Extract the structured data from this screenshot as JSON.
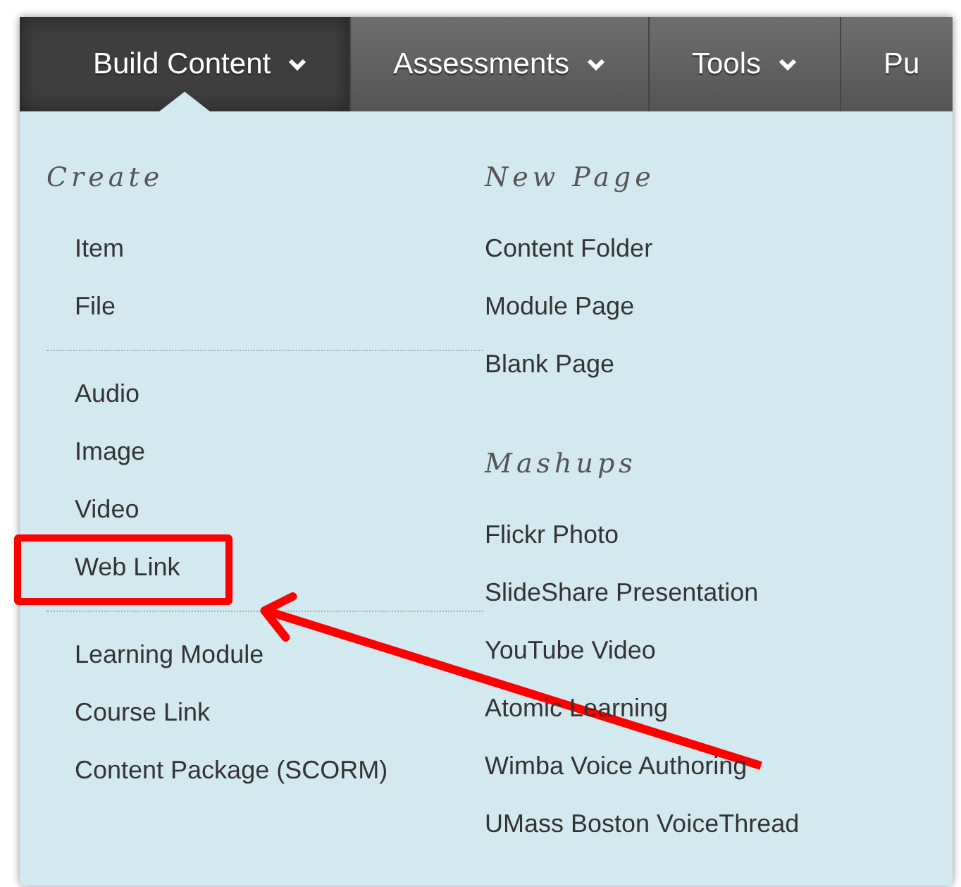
{
  "nav": {
    "tabs": [
      {
        "label": "Build Content",
        "selected": true,
        "caret": true
      },
      {
        "label": "Assessments",
        "selected": false,
        "caret": true
      },
      {
        "label": "Tools",
        "selected": false,
        "caret": true
      },
      {
        "label": "Pu",
        "selected": false,
        "caret": false
      }
    ]
  },
  "menu": {
    "columns": [
      {
        "sections": [
          {
            "heading": "Create",
            "groups": [
              [
                {
                  "label": "Item",
                  "highlighted": false
                },
                {
                  "label": "File",
                  "highlighted": false
                }
              ],
              [
                {
                  "label": "Audio",
                  "highlighted": false
                },
                {
                  "label": "Image",
                  "highlighted": false
                },
                {
                  "label": "Video",
                  "highlighted": false
                },
                {
                  "label": "Web Link",
                  "highlighted": true
                }
              ],
              [
                {
                  "label": "Learning Module",
                  "highlighted": false
                },
                {
                  "label": "Course Link",
                  "highlighted": false
                },
                {
                  "label": "Content Package (SCORM)",
                  "highlighted": false
                }
              ]
            ]
          }
        ]
      },
      {
        "sections": [
          {
            "heading": "New Page",
            "groups": [
              [
                {
                  "label": "Content Folder",
                  "highlighted": false
                },
                {
                  "label": "Module Page",
                  "highlighted": false
                },
                {
                  "label": "Blank Page",
                  "highlighted": false
                }
              ]
            ]
          },
          {
            "heading": "Mashups",
            "groups": [
              [
                {
                  "label": "Flickr Photo",
                  "highlighted": false
                },
                {
                  "label": "SlideShare Presentation",
                  "highlighted": false
                },
                {
                  "label": "YouTube Video",
                  "highlighted": false
                },
                {
                  "label": "Atomic Learning",
                  "highlighted": false
                },
                {
                  "label": "Wimba Voice Authoring",
                  "highlighted": false
                },
                {
                  "label": "UMass Boston VoiceThread",
                  "highlighted": false
                }
              ]
            ]
          }
        ]
      }
    ]
  }
}
